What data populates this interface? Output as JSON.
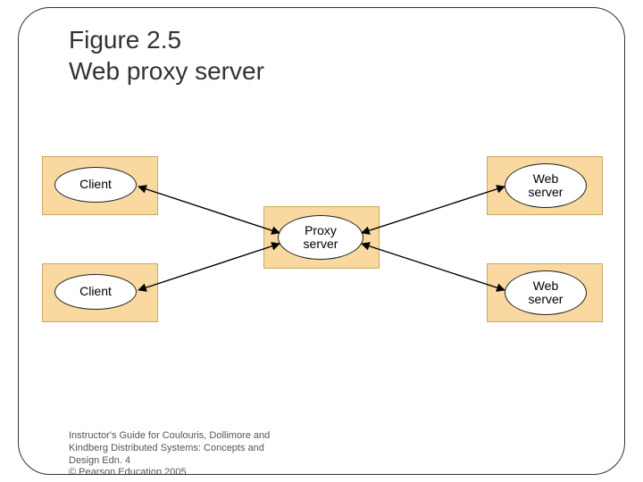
{
  "title_line1": "Figure 2.5",
  "title_line2": "Web proxy server",
  "nodes": {
    "client1": "Client",
    "client2": "Client",
    "proxy": "Proxy\nserver",
    "web1": "Web\nserver",
    "web2": "Web\nserver"
  },
  "footer": {
    "l1": "Instructor's Guide for  Coulouris, Dollimore and",
    "l2": "Kindberg   Distributed Systems: Concepts and",
    "l3": "Design   Edn. 4",
    "l4": "©  Pearson Education 2005"
  },
  "diagram_meta": {
    "type": "network-diagram",
    "edges": [
      [
        "client1",
        "proxy",
        "bidirectional"
      ],
      [
        "client2",
        "proxy",
        "bidirectional"
      ],
      [
        "proxy",
        "web1",
        "bidirectional"
      ],
      [
        "proxy",
        "web2",
        "bidirectional"
      ]
    ]
  }
}
